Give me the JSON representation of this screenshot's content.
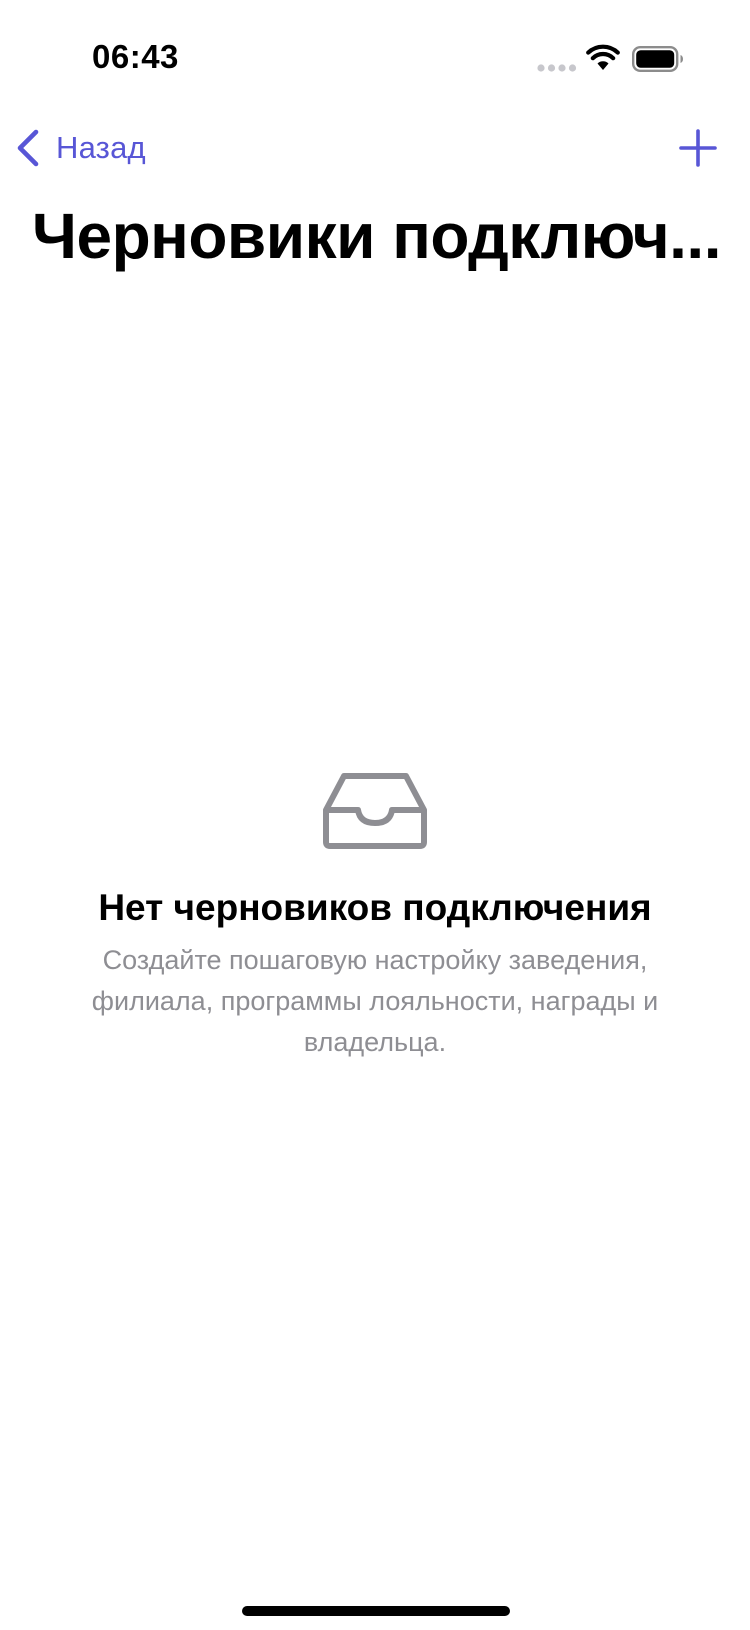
{
  "theme": {
    "accent_color": "#5856D6",
    "secondary_text_color": "#8E8E93",
    "icon_gray_color": "#8E8E93"
  },
  "status_bar": {
    "time": "06:43",
    "icons": [
      "signal-dots-icon",
      "wifi-icon",
      "battery-icon"
    ]
  },
  "nav_bar": {
    "back_label": "Назад",
    "back_icon": "chevron-left-icon",
    "add_icon": "plus-icon"
  },
  "page": {
    "title": "Черновики подключ..."
  },
  "empty_state": {
    "icon": "tray-icon",
    "title": "Нет черновиков подключения",
    "description": "Создайте пошаговую настройку заведения, филиала, программы лояльности, награды и владельца."
  }
}
